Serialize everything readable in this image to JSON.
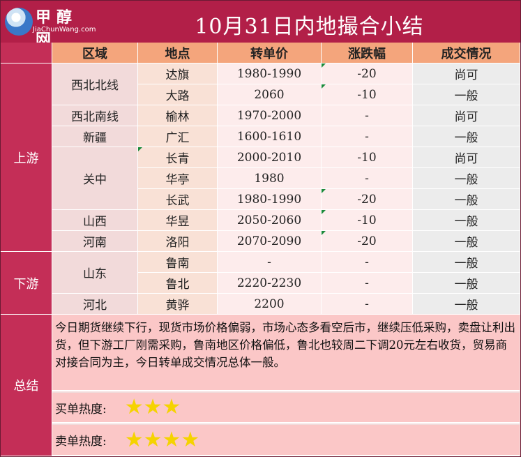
{
  "header": {
    "title": "10月31日内地撮合小结",
    "logo_cn": "甲醇网",
    "logo_en": "JiaChunWang.com"
  },
  "table": {
    "columns": [
      "区域",
      "地点",
      "转单价",
      "涨跌幅",
      "成交情况"
    ],
    "sections": [
      "上游",
      "下游",
      "总结"
    ],
    "regions": [
      "西北北线",
      "西北南线",
      "新疆",
      "关中",
      "山西",
      "河南",
      "山东",
      "河北"
    ],
    "rows": [
      {
        "place": "达旗",
        "price": "1980-1990",
        "change": "-20",
        "status": "尚可"
      },
      {
        "place": "大路",
        "price": "2060",
        "change": "-10",
        "status": "一般"
      },
      {
        "place": "榆林",
        "price": "1970-2000",
        "change": "-",
        "status": "尚可"
      },
      {
        "place": "广汇",
        "price": "1600-1610",
        "change": "-",
        "status": "一般"
      },
      {
        "place": "长青",
        "price": "2000-2010",
        "change": "-10",
        "status": "尚可"
      },
      {
        "place": "华亭",
        "price": "1980",
        "change": "-",
        "status": "一般"
      },
      {
        "place": "长武",
        "price": "1980-1990",
        "change": "-20",
        "status": "一般"
      },
      {
        "place": "华昱",
        "price": "2050-2060",
        "change": "-10",
        "status": "一般"
      },
      {
        "place": "洛阳",
        "price": "2070-2090",
        "change": "-20",
        "status": "一般"
      },
      {
        "place": "鲁南",
        "price": "-",
        "change": "-",
        "status": "一般"
      },
      {
        "place": "鲁北",
        "price": "2220-2230",
        "change": "-",
        "status": "一般"
      },
      {
        "place": "黄骅",
        "price": "2200",
        "change": "-",
        "status": "一般"
      }
    ]
  },
  "summary": {
    "text": "今日期货继续下行，现货市场价格偏弱，市场心态多看空后市，继续压低采购，卖盘让利出货，但下游工厂刚需采购，鲁南地区价格偏低，鲁北也较周二下调20元左右收货，贸易商对接合同为主，今日转单成交情况总体一般。",
    "buy_label": "买单热度:",
    "buy_stars": "★★★",
    "sell_label": "卖单热度:",
    "sell_stars": "★★★★"
  },
  "colors": {
    "title_bg": "#b21f48",
    "side_bg": "#c42e57",
    "header_bg": "#f4a57c",
    "summary_bg": "#fbc7c7",
    "star": "#f5d300"
  }
}
